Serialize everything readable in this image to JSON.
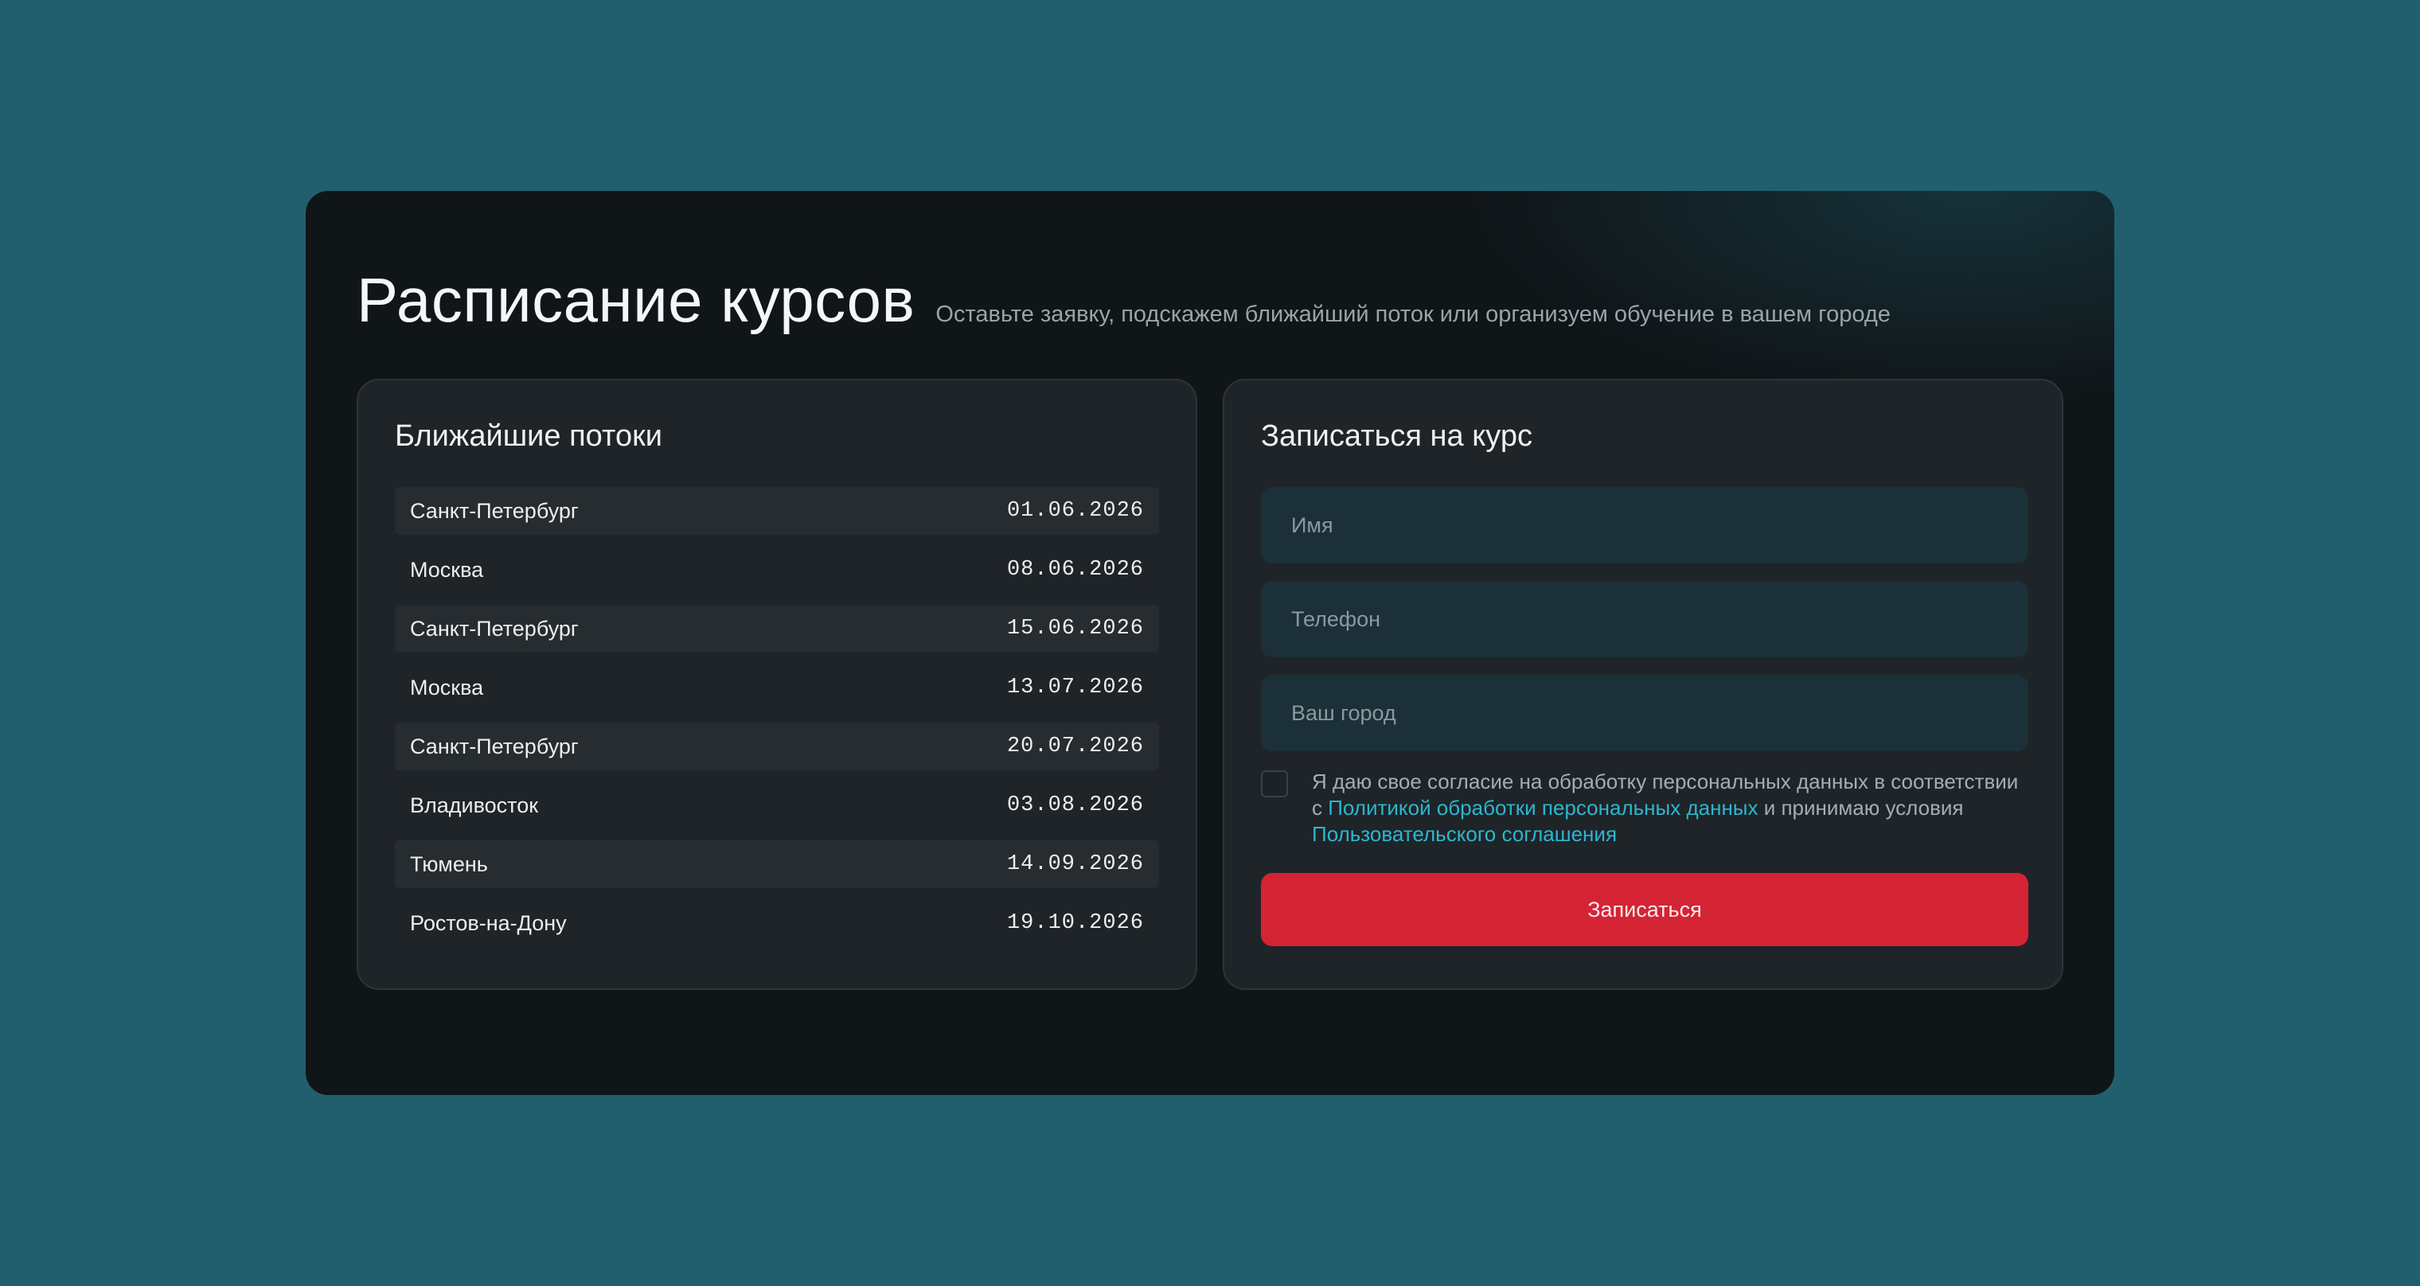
{
  "header": {
    "title": "Расписание курсов",
    "subtitle": "Оставьте заявку, подскажем ближайший поток или организуем обучение в вашем городе"
  },
  "schedule": {
    "title": "Ближайшие потоки",
    "rows": [
      {
        "city": "Санкт-Петербург",
        "date": "01.06.2026"
      },
      {
        "city": "Москва",
        "date": "08.06.2026"
      },
      {
        "city": "Санкт-Петербург",
        "date": "15.06.2026"
      },
      {
        "city": "Москва",
        "date": "13.07.2026"
      },
      {
        "city": "Санкт-Петербург",
        "date": "20.07.2026"
      },
      {
        "city": "Владивосток",
        "date": "03.08.2026"
      },
      {
        "city": "Тюмень",
        "date": "14.09.2026"
      },
      {
        "city": "Ростов-на-Дону",
        "date": "19.10.2026"
      }
    ]
  },
  "form": {
    "title": "Записаться на курс",
    "name_placeholder": "Имя",
    "name_value": "",
    "phone_placeholder": "Телефон",
    "phone_value": "",
    "city_placeholder": "Ваш город",
    "city_value": "",
    "consent_checked": false,
    "consent_text_1": "Я даю свое согласие на обработку персональных данных в соответствии с ",
    "consent_link_1": "Политикой обработки персональных данных",
    "consent_text_2": " и принимаю условия ",
    "consent_link_2": "Пользовательского соглашения",
    "submit_label": "Записаться"
  },
  "colors": {
    "background": "#215f6f",
    "card": "#101518",
    "panel": "#1f2428",
    "input": "#1b3038",
    "accent_link": "#2ab7cf",
    "submit": "#d42434"
  }
}
